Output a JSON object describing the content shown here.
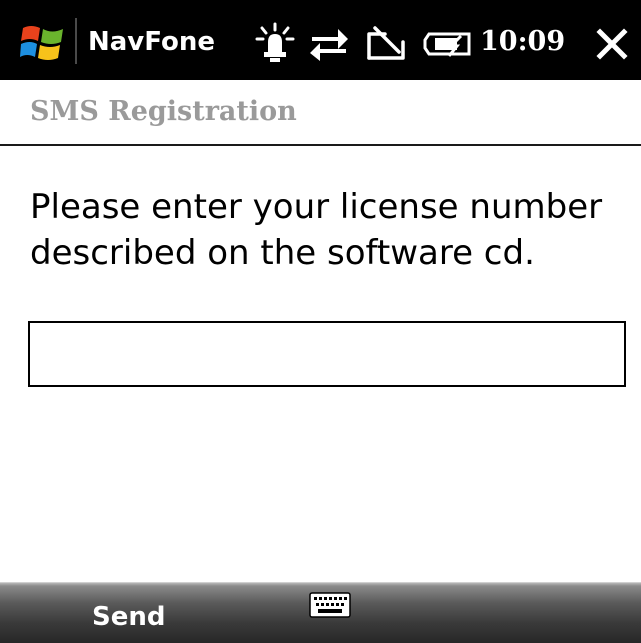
{
  "status_bar": {
    "app_title": "NavFone",
    "time": "10:09",
    "icons": [
      "windows-start-icon",
      "notification-icon",
      "connectivity-icon",
      "signal-off-icon",
      "battery-icon",
      "close-icon"
    ]
  },
  "header": {
    "title": "SMS Registration"
  },
  "content": {
    "instructions": "Please enter your license number described on the software cd.",
    "license_input": {
      "value": "",
      "placeholder": ""
    }
  },
  "softkeys": {
    "left_label": "Send",
    "center_icon": "keyboard-icon"
  }
}
